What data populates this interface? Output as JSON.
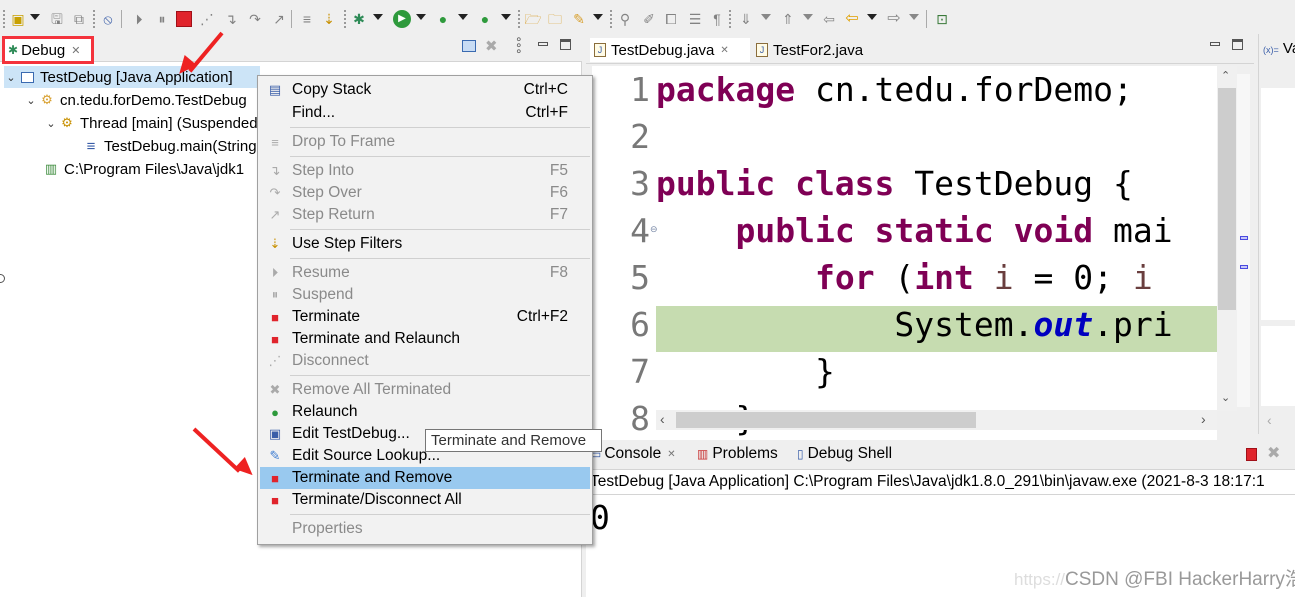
{
  "toolbar": {
    "buttons": [
      {
        "name": "new-icon",
        "glyph": "▣",
        "enabled": true
      },
      {
        "name": "save-icon",
        "glyph": "💾",
        "enabled": false
      },
      {
        "name": "save-all-icon",
        "glyph": "⧉",
        "enabled": false
      },
      {
        "name": "skip-breakpoints-icon",
        "glyph": "⦸",
        "enabled": true
      },
      {
        "name": "resume-icon",
        "glyph": "⏵",
        "enabled": false
      },
      {
        "name": "suspend-icon",
        "glyph": "⏸",
        "enabled": false
      },
      {
        "name": "terminate-icon",
        "glyph": "■",
        "enabled": true
      },
      {
        "name": "disconnect-icon",
        "glyph": "⋰",
        "enabled": false
      },
      {
        "name": "step-into-icon",
        "glyph": "↴",
        "enabled": false
      },
      {
        "name": "step-over-icon",
        "glyph": "↷",
        "enabled": false
      },
      {
        "name": "step-return-icon",
        "glyph": "↗",
        "enabled": false
      },
      {
        "name": "drop-to-frame-icon",
        "glyph": "≡",
        "enabled": false
      },
      {
        "name": "use-step-filters-icon",
        "glyph": "⇣",
        "enabled": true
      },
      {
        "name": "debug-icon",
        "glyph": "✱",
        "enabled": true
      },
      {
        "name": "run-icon",
        "glyph": "▶",
        "enabled": true
      },
      {
        "name": "coverage-icon",
        "glyph": "●",
        "enabled": true
      },
      {
        "name": "external-tools-icon",
        "glyph": "●",
        "enabled": true
      },
      {
        "name": "open-type-icon",
        "glyph": "📂",
        "enabled": true
      },
      {
        "name": "open-task-icon",
        "glyph": "📁",
        "enabled": true
      },
      {
        "name": "search-icon",
        "glyph": "✎",
        "enabled": true
      },
      {
        "name": "toggle-breadcrumb-icon",
        "glyph": "⚲",
        "enabled": false
      },
      {
        "name": "mark-occurrences-icon",
        "glyph": "✐",
        "enabled": false
      },
      {
        "name": "block-selection-icon",
        "glyph": "⧠",
        "enabled": false
      },
      {
        "name": "show-whitespace-icon",
        "glyph": "☰",
        "enabled": false
      },
      {
        "name": "pilcrow-icon",
        "glyph": "¶",
        "enabled": false
      },
      {
        "name": "next-annotation-icon",
        "glyph": "⇓",
        "enabled": false
      },
      {
        "name": "previous-annotation-icon",
        "glyph": "⇑",
        "enabled": false
      },
      {
        "name": "last-edit-location-icon",
        "glyph": "⇦",
        "enabled": false
      },
      {
        "name": "back-icon",
        "glyph": "⇦",
        "enabled": true
      },
      {
        "name": "forward-icon",
        "glyph": "⇨",
        "enabled": false
      },
      {
        "name": "pin-editor-icon",
        "glyph": "⊡",
        "enabled": true
      }
    ]
  },
  "debug_view": {
    "tab_label": "Debug",
    "tree": [
      {
        "label": "TestDebug [Java Application]",
        "icon": "launch-config-icon",
        "level": 0,
        "expanded": true,
        "selected": true
      },
      {
        "label": "cn.tedu.forDemo.TestDebug",
        "icon": "debug-target-icon",
        "level": 1,
        "expanded": true,
        "selected": false
      },
      {
        "label": "Thread [main] (Suspended",
        "icon": "thread-icon",
        "level": 2,
        "expanded": true,
        "selected": false
      },
      {
        "label": "TestDebug.main(String",
        "icon": "stack-frame-icon",
        "level": 3,
        "expanded": null,
        "selected": false
      },
      {
        "label": "C:\\Program Files\\Java\\jdk1",
        "icon": "process-icon",
        "level": 1,
        "expanded": null,
        "selected": false
      }
    ]
  },
  "context_menu": {
    "items": [
      {
        "label": "Copy Stack",
        "shortcut": "Ctrl+C",
        "icon": "copy-icon",
        "glyph": "▤",
        "enabled": true,
        "selected": false
      },
      {
        "label": "Find...",
        "shortcut": "Ctrl+F",
        "icon": "",
        "glyph": "",
        "enabled": true,
        "selected": false
      },
      {
        "sep": true
      },
      {
        "label": "Drop To Frame",
        "shortcut": "",
        "icon": "drop-to-frame-icon",
        "glyph": "≡",
        "enabled": false,
        "selected": false
      },
      {
        "sep": true
      },
      {
        "label": "Step Into",
        "shortcut": "F5",
        "icon": "step-into-icon",
        "glyph": "↴",
        "enabled": false,
        "selected": false
      },
      {
        "label": "Step Over",
        "shortcut": "F6",
        "icon": "step-over-icon",
        "glyph": "↷",
        "enabled": false,
        "selected": false
      },
      {
        "label": "Step Return",
        "shortcut": "F7",
        "icon": "step-return-icon",
        "glyph": "↗",
        "enabled": false,
        "selected": false
      },
      {
        "sep": true
      },
      {
        "label": "Use Step Filters",
        "shortcut": "",
        "icon": "use-step-filters-icon",
        "glyph": "⇣",
        "enabled": true,
        "selected": false
      },
      {
        "sep": true
      },
      {
        "label": "Resume",
        "shortcut": "F8",
        "icon": "resume-icon",
        "glyph": "⏵",
        "enabled": false,
        "selected": false
      },
      {
        "label": "Suspend",
        "shortcut": "",
        "icon": "suspend-icon",
        "glyph": "⏸",
        "enabled": false,
        "selected": false
      },
      {
        "label": "Terminate",
        "shortcut": "Ctrl+F2",
        "icon": "terminate-icon",
        "glyph": "■",
        "enabled": true,
        "selected": false
      },
      {
        "label": "Terminate and Relaunch",
        "shortcut": "",
        "icon": "terminate-relaunch-icon",
        "glyph": "■",
        "enabled": true,
        "selected": false
      },
      {
        "label": "Disconnect",
        "shortcut": "",
        "icon": "disconnect-icon",
        "glyph": "⋰",
        "enabled": false,
        "selected": false
      },
      {
        "sep": true
      },
      {
        "label": "Remove All Terminated",
        "shortcut": "",
        "icon": "remove-all-terminated-icon",
        "glyph": "✖",
        "enabled": false,
        "selected": false
      },
      {
        "label": "Relaunch",
        "shortcut": "",
        "icon": "relaunch-icon",
        "glyph": "●",
        "enabled": true,
        "selected": false
      },
      {
        "label": "Edit TestDebug...",
        "shortcut": "",
        "icon": "edit-config-icon",
        "glyph": "▣",
        "enabled": true,
        "selected": false
      },
      {
        "label": "Edit Source Lookup...",
        "shortcut": "",
        "icon": "edit-source-lookup-icon",
        "glyph": "✎",
        "enabled": true,
        "selected": false
      },
      {
        "label": "Terminate and Remove",
        "shortcut": "",
        "icon": "terminate-remove-icon",
        "glyph": "■",
        "enabled": true,
        "selected": true
      },
      {
        "label": "Terminate/Disconnect All",
        "shortcut": "",
        "icon": "terminate-all-icon",
        "glyph": "■",
        "enabled": true,
        "selected": false
      },
      {
        "sep": true
      },
      {
        "label": "Properties",
        "shortcut": "",
        "icon": "",
        "glyph": "",
        "enabled": false,
        "selected": false
      }
    ]
  },
  "tooltip": {
    "text": "Terminate and Remove"
  },
  "editor": {
    "tabs": [
      {
        "label": "TestDebug.java",
        "active": true,
        "closable": true
      },
      {
        "label": "TestFor2.java",
        "active": false,
        "closable": false
      }
    ],
    "line_numbers": [
      "1",
      "2",
      "3",
      "4",
      "5",
      "6",
      "7",
      "8"
    ],
    "current_line": "6"
  },
  "variables_view": {
    "tab_label": "Va"
  },
  "console": {
    "tabs": [
      {
        "label": "Console",
        "active": true
      },
      {
        "label": "Problems",
        "active": false
      },
      {
        "label": "Debug Shell",
        "active": false
      }
    ],
    "header": "TestDebug [Java Application] C:\\Program Files\\Java\\jdk1.8.0_291\\bin\\javaw.exe  (2021-8-3 18:17:1",
    "output": "0"
  },
  "watermark": {
    "text": "CSDN @FBI HackerHarry浩",
    "url_fragment": "https://"
  },
  "colors": {
    "highlight": "#f4333c",
    "menu_selection": "#99c9ef",
    "current_line": "#c6dcb0",
    "keyword": "#7f0055",
    "field": "#0000c0"
  }
}
